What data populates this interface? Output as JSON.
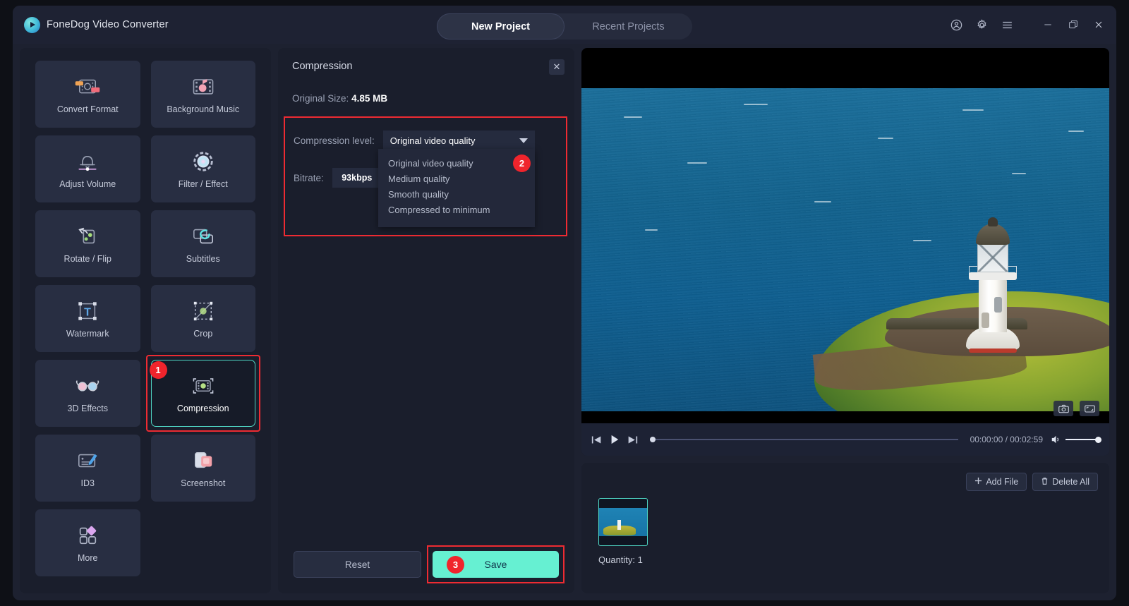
{
  "app": {
    "brand": "FoneDog Video Converter",
    "logo_icon": "play-circle-icon"
  },
  "titlebar": {
    "tabs": [
      {
        "label": "New Project",
        "active": true
      },
      {
        "label": "Recent Projects",
        "active": false
      }
    ],
    "icons": [
      {
        "name": "account-icon",
        "glyph": "ⓘ"
      },
      {
        "name": "settings-gear-icon",
        "glyph": "⚙"
      },
      {
        "name": "hamburger-menu-icon",
        "glyph": "≡"
      },
      {
        "name": "minimize-icon",
        "glyph": "–"
      },
      {
        "name": "maximize-icon",
        "glyph": "❐"
      },
      {
        "name": "close-icon",
        "glyph": "✕"
      }
    ]
  },
  "tools": [
    {
      "label": "Convert Format",
      "icon": "convert-format-icon",
      "selected": false
    },
    {
      "label": "Background Music",
      "icon": "background-music-icon",
      "selected": false
    },
    {
      "label": "Adjust Volume",
      "icon": "adjust-volume-icon",
      "selected": false
    },
    {
      "label": "Filter / Effect",
      "icon": "filter-effect-icon",
      "selected": false
    },
    {
      "label": "Rotate / Flip",
      "icon": "rotate-flip-icon",
      "selected": false
    },
    {
      "label": "Subtitles",
      "icon": "subtitles-icon",
      "selected": false
    },
    {
      "label": "Watermark",
      "icon": "watermark-icon",
      "selected": false
    },
    {
      "label": "Crop",
      "icon": "crop-icon",
      "selected": false
    },
    {
      "label": "3D Effects",
      "icon": "3d-effects-icon",
      "selected": false
    },
    {
      "label": "Compression",
      "icon": "compression-icon",
      "selected": true,
      "badge": "1"
    },
    {
      "label": "ID3",
      "icon": "id3-icon",
      "selected": false
    },
    {
      "label": "Screenshot",
      "icon": "screenshot-icon",
      "selected": false
    },
    {
      "label": "More",
      "icon": "more-icon",
      "selected": false
    }
  ],
  "compression_panel": {
    "title": "Compression",
    "close_label": "✕",
    "original_size_label": "Original Size:",
    "original_size_value": "4.85 MB",
    "level_label": "Compression level:",
    "level_value": "Original video quality",
    "level_options": [
      "Original video quality",
      "Medium quality",
      "Smooth quality",
      "Compressed to minimum"
    ],
    "dropdown_badge": "2",
    "bitrate_label": "Bitrate:",
    "bitrate_value": "93kbps",
    "reset_label": "Reset",
    "save_label": "Save",
    "save_badge": "3"
  },
  "player": {
    "screenshot_icon": "camera-icon",
    "gif_icon": "frame-capture-icon",
    "prev_icon": "skip-previous-icon",
    "play_icon": "play-icon",
    "next_icon": "skip-next-icon",
    "volume_icon": "speaker-icon",
    "current_time": "00:00:00",
    "total_time": "00:02:59",
    "time_display": "00:00:00 / 00:02:59"
  },
  "filelist": {
    "add_file_label": "Add File",
    "add_file_icon": "plus-icon",
    "delete_all_label": "Delete All",
    "delete_all_icon": "trash-icon",
    "quantity_label": "Quantity: 1"
  },
  "colors": {
    "accent_teal": "#66f0d2",
    "highlight_red": "#ee2b32",
    "badge_red": "#f0242c",
    "panel_bg": "#1a1e2c",
    "tile_bg": "#282e42"
  }
}
